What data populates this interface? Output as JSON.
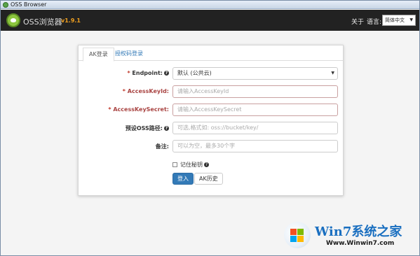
{
  "window": {
    "title": "OSS Browser"
  },
  "header": {
    "brand": "OSS浏览器",
    "version": "v1.9.1",
    "about": "关于",
    "language_label": "语言:",
    "language_value": "简体中文"
  },
  "tabs": [
    {
      "label": "AK登录",
      "active": true
    },
    {
      "label": "授权码登录",
      "active": false
    }
  ],
  "form": {
    "endpoint": {
      "label": "Endpoint:",
      "value": "默认 (公共云)"
    },
    "access_key_id": {
      "label": "AccessKeyId:",
      "placeholder": "请输入AccessKeyId"
    },
    "access_key_secret": {
      "label": "AccessKeySecret:",
      "placeholder": "请输入AccessKeySecret"
    },
    "oss_path": {
      "label": "预设OSS路径:",
      "placeholder": "可选,格式如: oss://bucket/key/"
    },
    "note": {
      "label": "备注:",
      "placeholder": "可以为空，最多30个字"
    },
    "remember_label": "记住秘钥",
    "login_button": "登入",
    "history_button": "AK历史"
  },
  "watermark": {
    "brand": "Win7系统之家",
    "url": "Www.Winwin7.com"
  },
  "colors": {
    "header_bg": "#222222",
    "version": "#f0a020",
    "primary": "#337ab7",
    "required": "#c0392b"
  }
}
